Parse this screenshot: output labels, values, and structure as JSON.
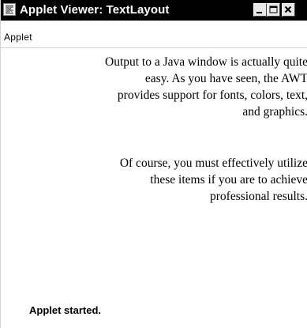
{
  "window": {
    "title": "Applet Viewer: TextLayout",
    "app_icon": "applet-viewer-icon",
    "controls": {
      "minimize_icon": "minimize-icon",
      "maximize_icon": "maximize-icon",
      "close_icon": "close-icon"
    }
  },
  "menubar": {
    "items": [
      {
        "label": "Applet"
      }
    ]
  },
  "content": {
    "paragraphs": [
      {
        "lines": [
          "Output to a Java window is actually quite",
          "easy.  As you have seen, the AWT",
          "provides support for fonts, colors, text,",
          "and graphics."
        ]
      },
      {
        "lines": [
          "Of course, you must effectively utilize",
          "these items if you are to achieve",
          "professional results."
        ]
      }
    ]
  },
  "status": {
    "text": "Applet started."
  }
}
